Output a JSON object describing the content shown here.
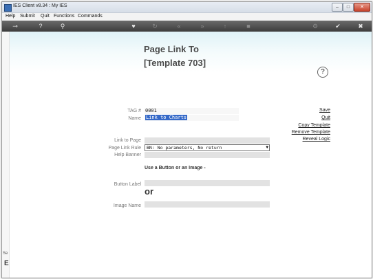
{
  "window": {
    "title": "IES Client v8.34 : My IES",
    "min": "–",
    "max": "□",
    "close": "✕"
  },
  "menu": [
    "Help",
    "Submit",
    "Quit",
    "Functions",
    "Commands"
  ],
  "toolbar": {
    "key": "⊸",
    "help": "?",
    "search": "⚲",
    "heart": "♥",
    "refresh": "↻",
    "back": "«",
    "forward": "»",
    "up": "↑",
    "stop": "■",
    "gear": "⚙",
    "ok": "✔",
    "close": "✖"
  },
  "page": {
    "title": "Page Link To",
    "subtitle": "[Template 703]"
  },
  "form": {
    "tag_label": "TAG #",
    "tag_value": "0001",
    "name_label": "Name",
    "name_value": "Link to Charts",
    "link_to_page_label": "Link to Page",
    "link_to_page_value": "",
    "page_link_rule_label": "Page Link Rule",
    "page_link_rule_value": "BN: No parameters, No return",
    "help_banner_label": "Help Banner",
    "help_banner_value": "",
    "use_button_text": "Use a Button or an Image -",
    "button_label_label": "Button Label",
    "button_label_value": "",
    "or_text": "or",
    "image_name_label": "Image Name",
    "image_name_value": ""
  },
  "actions": {
    "help": "?",
    "save": "Save",
    "quit": "Quit",
    "copy": "Copy Template",
    "remove": "Remove Template",
    "reveal": "Reveal Logic"
  },
  "sidebar": {
    "s": "Se",
    "e": "E"
  }
}
